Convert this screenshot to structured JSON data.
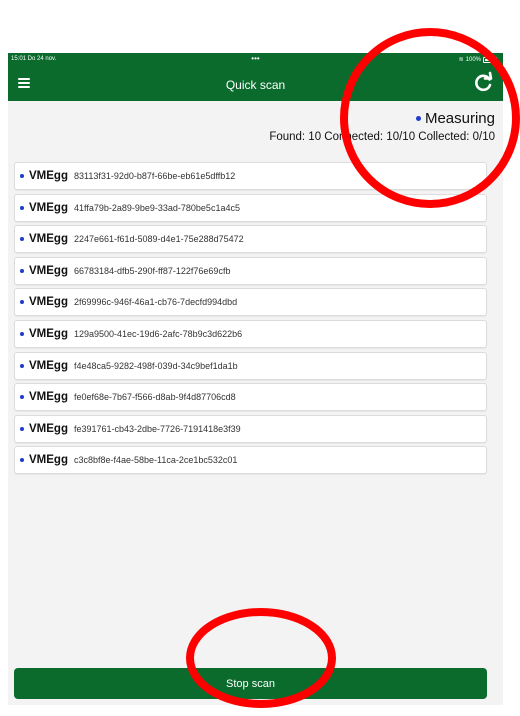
{
  "status_bar": {
    "time": "15:01  Do 24 nov.",
    "dots": "•••",
    "battery": "100%"
  },
  "header": {
    "title": "Quick scan",
    "menu_icon": "hamburger-menu-icon",
    "refresh_icon": "refresh-icon"
  },
  "status": {
    "state": "Measuring",
    "counts": "Found: 10  Connected: 10/10  Collected: 0/10"
  },
  "devices": [
    {
      "name": "VMEgg",
      "id": "83113f31-92d0-b87f-66be-eb61e5dffb12"
    },
    {
      "name": "VMEgg",
      "id": "41ffa79b-2a89-9be9-33ad-780be5c1a4c5"
    },
    {
      "name": "VMEgg",
      "id": "2247e661-f61d-5089-d4e1-75e288d75472"
    },
    {
      "name": "VMEgg",
      "id": "66783184-dfb5-290f-ff87-122f76e69cfb"
    },
    {
      "name": "VMEgg",
      "id": "2f69996c-946f-46a1-cb76-7decfd994dbd"
    },
    {
      "name": "VMEgg",
      "id": "129a9500-41ec-19d6-2afc-78b9c3d622b6"
    },
    {
      "name": "VMEgg",
      "id": "f4e48ca5-9282-498f-039d-34c9bef1da1b"
    },
    {
      "name": "VMEgg",
      "id": "fe0ef68e-7b67-f566-d8ab-9f4d87706cd8"
    },
    {
      "name": "VMEgg",
      "id": "fe391761-cb43-2dbe-7726-7191418e3f39"
    },
    {
      "name": "VMEgg",
      "id": "c3c8bf8e-f4ae-58be-11ca-2ce1bc532c01"
    }
  ],
  "actions": {
    "stop_label": "Stop scan"
  },
  "colors": {
    "brand_green": "#0a6b2d",
    "dot_blue": "#1f3bd1",
    "annotation_red": "#ff0000"
  }
}
